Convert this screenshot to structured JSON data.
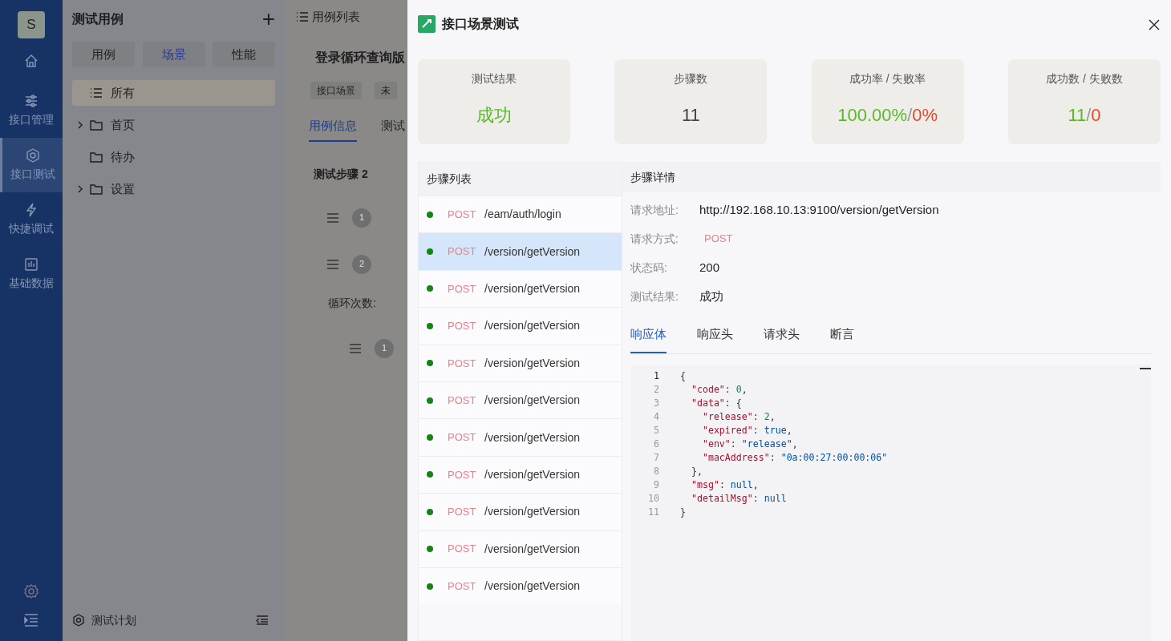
{
  "nav": {
    "avatar": "S",
    "items": [
      {
        "selected": false
      },
      {
        "label": "接口管理",
        "selected": false
      },
      {
        "label": "接口测试",
        "selected": true
      },
      {
        "label": "快捷调试",
        "selected": false
      },
      {
        "label": "基础数据",
        "selected": false
      }
    ]
  },
  "case_panel": {
    "title": "测试用例",
    "add": "+",
    "tabs": [
      {
        "label": "用例",
        "selected": false
      },
      {
        "label": "场景",
        "selected": true
      },
      {
        "label": "性能",
        "selected": false
      }
    ],
    "tree": [
      {
        "label": "所有",
        "kind": "all",
        "selected": true,
        "expandable": false
      },
      {
        "label": "首页",
        "kind": "folder",
        "selected": false,
        "expandable": true
      },
      {
        "label": "待办",
        "kind": "folder",
        "selected": false,
        "expandable": false
      },
      {
        "label": "设置",
        "kind": "folder",
        "selected": false,
        "expandable": true
      }
    ],
    "footer": "测试计划"
  },
  "main": {
    "breadcrumb": "用例列表",
    "title": "登录循环查询版",
    "tags": [
      "接口场景",
      "未"
    ],
    "tabs": [
      {
        "label": "用例信息",
        "selected": true
      },
      {
        "label": "测试",
        "selected": false
      }
    ],
    "section": "测试步骤 2",
    "steps": [
      "1",
      "2"
    ],
    "loop_label": "循环次数:",
    "nested_step": "1"
  },
  "drawer": {
    "title": "接口场景测试",
    "stats": [
      {
        "label": "测试结果",
        "values": [
          {
            "text": "成功",
            "color": "#5cb82a"
          }
        ]
      },
      {
        "label": "步骤数",
        "values": [
          {
            "text": "11",
            "color": "#444444"
          }
        ]
      },
      {
        "label": "成功率 / 失败率",
        "values": [
          {
            "text": "100.00%",
            "color": "#5cb82a"
          },
          {
            "text": "0%",
            "color": "#e8472a"
          }
        ]
      },
      {
        "label": "成功数 / 失败数",
        "values": [
          {
            "text": "11",
            "color": "#5cb82a"
          },
          {
            "text": "0",
            "color": "#e8472a"
          }
        ]
      }
    ],
    "separator": "/",
    "step_list": {
      "title": "步骤列表",
      "items": [
        {
          "method": "POST",
          "path": "/eam/auth/login",
          "passed": true,
          "selected": false
        },
        {
          "method": "POST",
          "path": "/version/getVersion",
          "passed": true,
          "selected": true
        },
        {
          "method": "POST",
          "path": "/version/getVersion",
          "passed": true,
          "selected": false
        },
        {
          "method": "POST",
          "path": "/version/getVersion",
          "passed": true,
          "selected": false
        },
        {
          "method": "POST",
          "path": "/version/getVersion",
          "passed": true,
          "selected": false
        },
        {
          "method": "POST",
          "path": "/version/getVersion",
          "passed": true,
          "selected": false
        },
        {
          "method": "POST",
          "path": "/version/getVersion",
          "passed": true,
          "selected": false
        },
        {
          "method": "POST",
          "path": "/version/getVersion",
          "passed": true,
          "selected": false
        },
        {
          "method": "POST",
          "path": "/version/getVersion",
          "passed": true,
          "selected": false
        },
        {
          "method": "POST",
          "path": "/version/getVersion",
          "passed": true,
          "selected": false
        },
        {
          "method": "POST",
          "path": "/version/getVersion",
          "passed": true,
          "selected": false
        }
      ]
    },
    "detail": {
      "title": "步骤详情",
      "fields": [
        {
          "label": "请求地址:",
          "value": "http://192.168.10.13:9100/version/getVersion",
          "kind": "text"
        },
        {
          "label": "请求方式:",
          "value": "POST",
          "kind": "method"
        },
        {
          "label": "状态码:",
          "value": "200",
          "kind": "text"
        },
        {
          "label": "测试结果:",
          "value": "成功",
          "kind": "text"
        }
      ],
      "tabs": [
        {
          "label": "响应体",
          "selected": true
        },
        {
          "label": "响应头",
          "selected": false
        },
        {
          "label": "请求头",
          "selected": false
        },
        {
          "label": "断言",
          "selected": false
        }
      ],
      "code": [
        {
          "number": "1",
          "text": "{"
        },
        {
          "number": "2",
          "text": "  \"code\": 0,"
        },
        {
          "number": "3",
          "text": "  \"data\": {"
        },
        {
          "number": "4",
          "text": "    \"release\": 2,"
        },
        {
          "number": "5",
          "text": "    \"expired\": true,"
        },
        {
          "number": "6",
          "text": "    \"env\": \"release\","
        },
        {
          "number": "7",
          "text": "    \"macAddress\": \"0a:00:27:00:00:06\""
        },
        {
          "number": "8",
          "text": "  },"
        },
        {
          "number": "9",
          "text": "  \"msg\": null,"
        },
        {
          "number": "10",
          "text": "  \"detailMsg\": null"
        },
        {
          "number": "11",
          "text": "}"
        }
      ]
    }
  }
}
